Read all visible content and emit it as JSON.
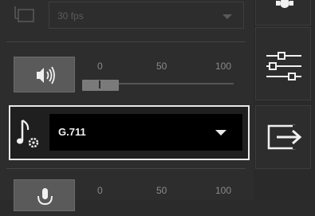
{
  "fps": {
    "value": "30 fps"
  },
  "volume": {
    "scale_labels": [
      "0",
      "50",
      "100"
    ],
    "level_percent": 10
  },
  "codec": {
    "value": "G.711"
  },
  "mic": {
    "scale_labels": [
      "0",
      "50",
      "100"
    ]
  },
  "sidebar": {
    "items": [
      {
        "icon": "gear-icon"
      },
      {
        "icon": "sliders-icon"
      },
      {
        "icon": "exit-icon"
      }
    ]
  }
}
